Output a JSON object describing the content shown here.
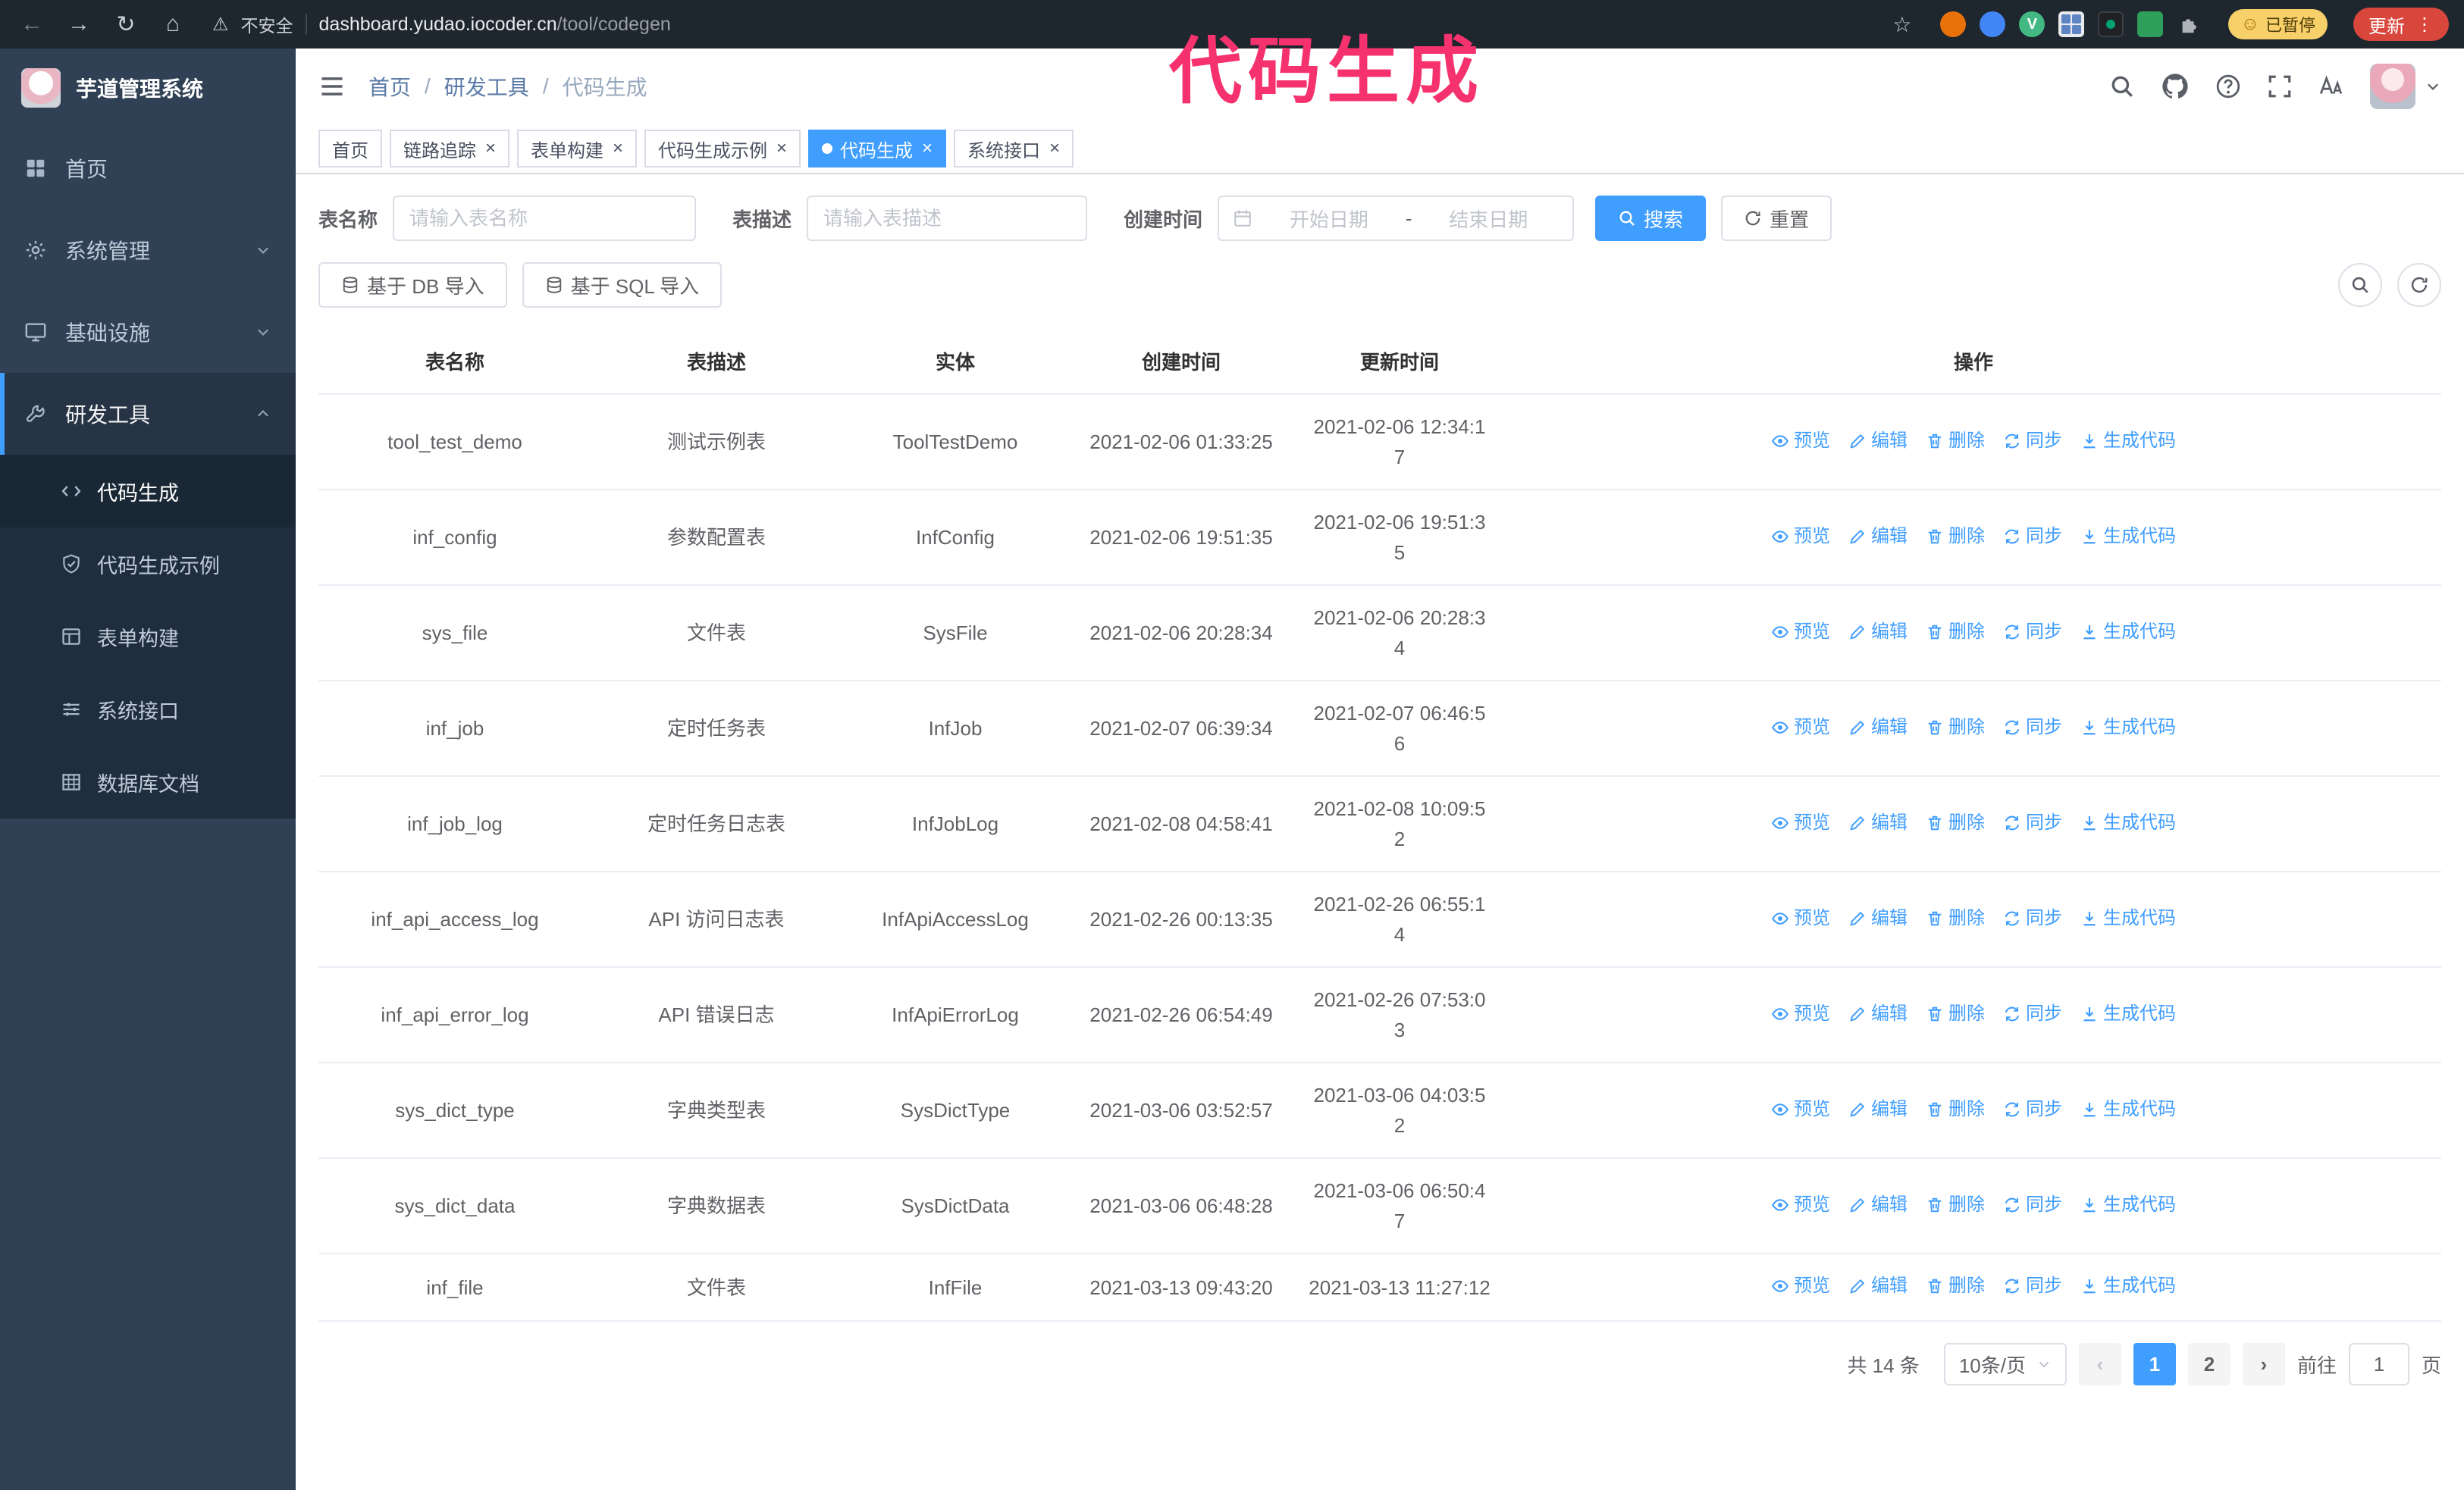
{
  "annotation": "代码生成",
  "colors": {
    "accent": "#409EFF",
    "annotation_pink": "#F5326E",
    "sidebar_bg": "#304156",
    "submenu_bg": "#1F2D3D",
    "chrome_bg": "#1E262E",
    "update_red": "#D9463C"
  },
  "icons": {
    "back": "←",
    "forward": "→",
    "reload": "↻",
    "home": "⌂",
    "warning": "⚠",
    "star": "☆",
    "kebab": "⋮",
    "close": "×",
    "prev": "‹",
    "next": "›",
    "smiley": "☺",
    "vue_badge": "V"
  },
  "browser": {
    "security_label": "不安全",
    "url_domain": "dashboard.yudao.iocoder.cn",
    "url_path": "/tool/codegen",
    "paused_badge": "已暂停",
    "update_label": "更新"
  },
  "sidebar": {
    "logo_title": "芋道管理系统",
    "items": [
      {
        "label": "首页"
      },
      {
        "label": "系统管理"
      },
      {
        "label": "基础设施"
      },
      {
        "label": "研发工具"
      }
    ],
    "subitems": [
      {
        "label": "代码生成"
      },
      {
        "label": "代码生成示例"
      },
      {
        "label": "表单构建"
      },
      {
        "label": "系统接口"
      },
      {
        "label": "数据库文档"
      }
    ]
  },
  "topbar": {
    "breadcrumb": [
      "首页",
      "研发工具",
      "代码生成"
    ],
    "separator": "/"
  },
  "tabs": [
    {
      "label": "首页"
    },
    {
      "label": "链路追踪"
    },
    {
      "label": "表单构建"
    },
    {
      "label": "代码生成示例"
    },
    {
      "label": "代码生成"
    },
    {
      "label": "系统接口"
    }
  ],
  "filters": {
    "table_name_label": "表名称",
    "table_name_placeholder": "请输入表名称",
    "table_desc_label": "表描述",
    "table_desc_placeholder": "请输入表描述",
    "create_time_label": "创建时间",
    "date_start_placeholder": "开始日期",
    "date_separator": "-",
    "date_end_placeholder": "结束日期",
    "search_button": "搜索",
    "reset_button": "重置"
  },
  "toolbar": {
    "import_db": "基于 DB 导入",
    "import_sql": "基于 SQL 导入"
  },
  "table": {
    "columns": [
      "表名称",
      "表描述",
      "实体",
      "创建时间",
      "更新时间",
      "操作"
    ],
    "row_actions": [
      "预览",
      "编辑",
      "删除",
      "同步",
      "生成代码"
    ],
    "rows": [
      [
        "tool_test_demo",
        "测试示例表",
        "ToolTestDemo",
        "2021-02-06 01:33:25",
        "2021-02-06 12:34:17"
      ],
      [
        "inf_config",
        "参数配置表",
        "InfConfig",
        "2021-02-06 19:51:35",
        "2021-02-06 19:51:35"
      ],
      [
        "sys_file",
        "文件表",
        "SysFile",
        "2021-02-06 20:28:34",
        "2021-02-06 20:28:34"
      ],
      [
        "inf_job",
        "定时任务表",
        "InfJob",
        "2021-02-07 06:39:34",
        "2021-02-07 06:46:56"
      ],
      [
        "inf_job_log",
        "定时任务日志表",
        "InfJobLog",
        "2021-02-08 04:58:41",
        "2021-02-08 10:09:52"
      ],
      [
        "inf_api_access_log",
        "API 访问日志表",
        "InfApiAccessLog",
        "2021-02-26 00:13:35",
        "2021-02-26 06:55:14"
      ],
      [
        "inf_api_error_log",
        "API 错误日志",
        "InfApiErrorLog",
        "2021-02-26 06:54:49",
        "2021-02-26 07:53:03"
      ],
      [
        "sys_dict_type",
        "字典类型表",
        "SysDictType",
        "2021-03-06 03:52:57",
        "2021-03-06 04:03:52"
      ],
      [
        "sys_dict_data",
        "字典数据表",
        "SysDictData",
        "2021-03-06 06:48:28",
        "2021-03-06 06:50:47"
      ],
      [
        "inf_file",
        "文件表",
        "InfFile",
        "2021-03-13 09:43:20",
        "2021-03-13 11:27:12"
      ]
    ]
  },
  "pagination": {
    "total": "共 14 条",
    "page_size": "10条/页",
    "pages": [
      "1",
      "2"
    ],
    "goto_label": "前往",
    "goto_value": "1",
    "goto_suffix": "页"
  }
}
